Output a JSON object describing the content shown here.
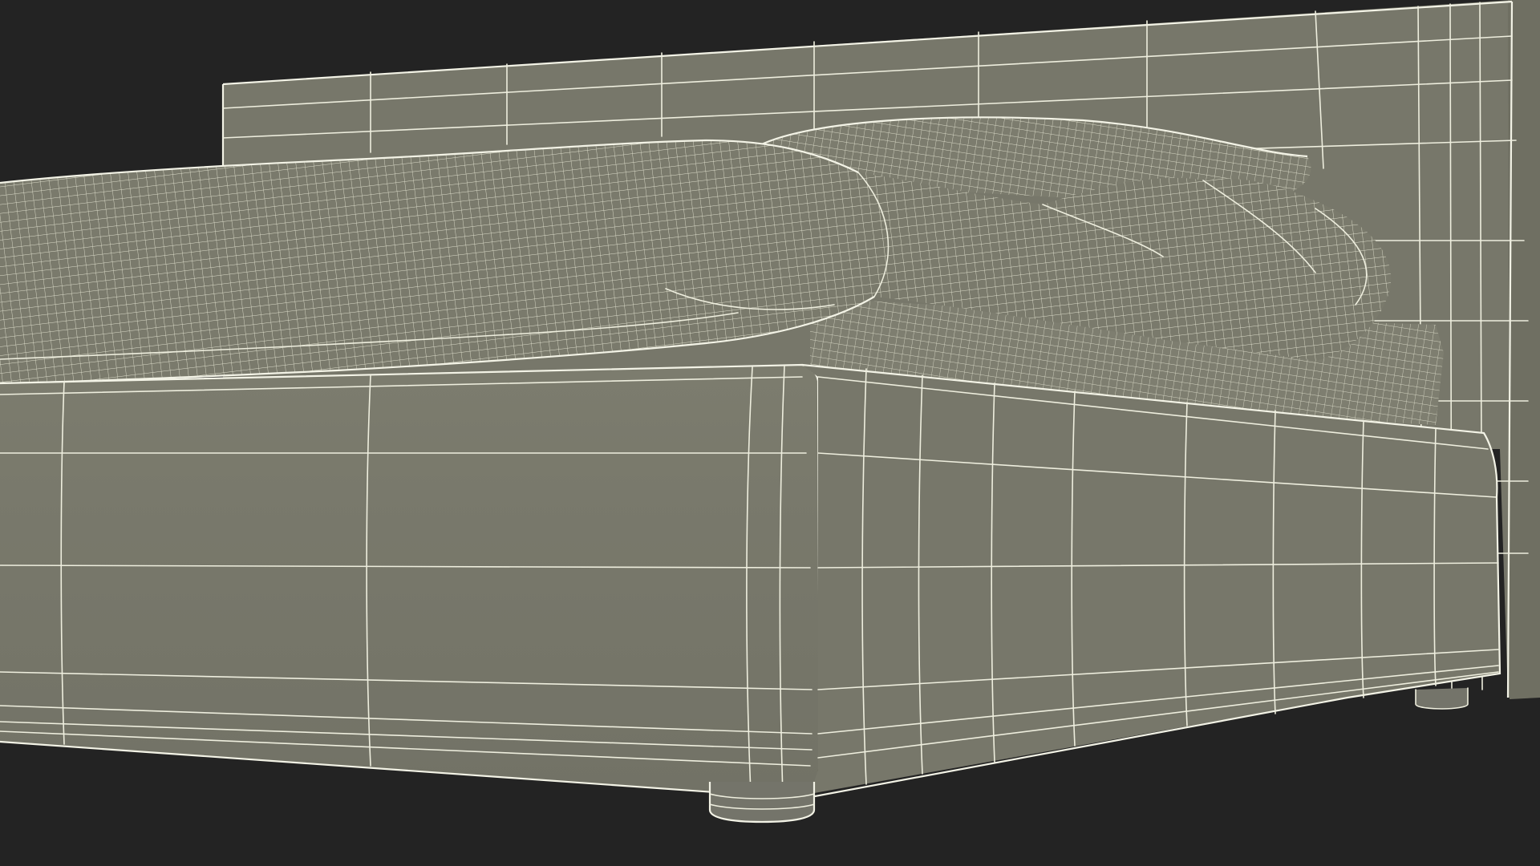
{
  "scene": {
    "subject": "bed-wireframe",
    "colors": {
      "background": "#232323",
      "surface": "#7a7a6c",
      "surface_shadow": "#6d6d60",
      "wire": "#eeeede",
      "leg": "#74746a"
    }
  }
}
